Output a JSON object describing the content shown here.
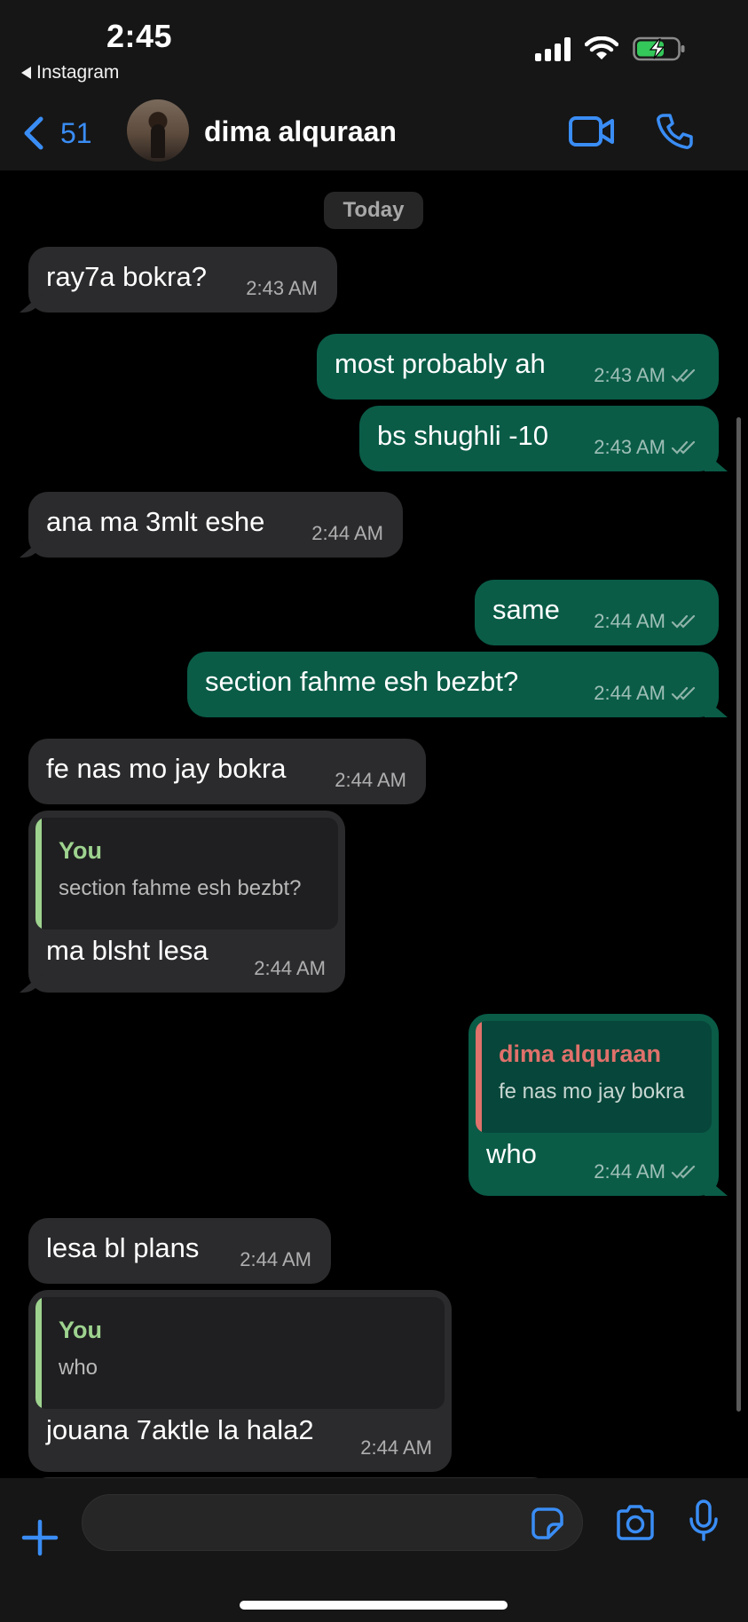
{
  "status_bar": {
    "time": "2:45",
    "back_app": "Instagram",
    "battery": "charging"
  },
  "header": {
    "back_count": "51",
    "contact_name": "dima alquraan"
  },
  "chat": {
    "date_divider": "Today",
    "messages": [
      {
        "dir": "in",
        "text": "ray7a bokra?",
        "time": "2:43 AM"
      },
      {
        "dir": "out",
        "text": "most probably ah",
        "time": "2:43 AM",
        "read": true
      },
      {
        "dir": "out",
        "text": "bs shughli -10",
        "time": "2:43 AM",
        "read": true
      },
      {
        "dir": "in",
        "text": "ana ma 3mlt eshe",
        "time": "2:44 AM"
      },
      {
        "dir": "out",
        "text": "same",
        "time": "2:44 AM",
        "read": true
      },
      {
        "dir": "out",
        "text": "section fahme esh bezbt?",
        "time": "2:44 AM",
        "read": true
      },
      {
        "dir": "in",
        "text": "fe nas mo jay bokra",
        "time": "2:44 AM"
      },
      {
        "dir": "in",
        "text": "ma blsht lesa",
        "time": "2:44 AM",
        "reply_to": {
          "name": "You",
          "text": "section fahme esh bezbt?"
        }
      },
      {
        "dir": "out",
        "text": "who",
        "time": "2:44 AM",
        "read": true,
        "reply_to": {
          "name": "dima alquraan",
          "text": "fe nas mo jay bokra"
        }
      },
      {
        "dir": "in",
        "text": "lesa bl plans",
        "time": "2:44 AM"
      },
      {
        "dir": "in",
        "text": "jouana 7aktle la hala2",
        "time": "2:44 AM",
        "reply_to": {
          "name": "You",
          "text": "who"
        }
      }
    ]
  },
  "colors": {
    "accent": "#3a8df5",
    "outgoing_bubble": "#0a5c47",
    "incoming_bubble": "#2b2b2d",
    "quote_you": "#9ed38f",
    "quote_contact": "#e0716b"
  },
  "composer": {
    "input_value": ""
  }
}
